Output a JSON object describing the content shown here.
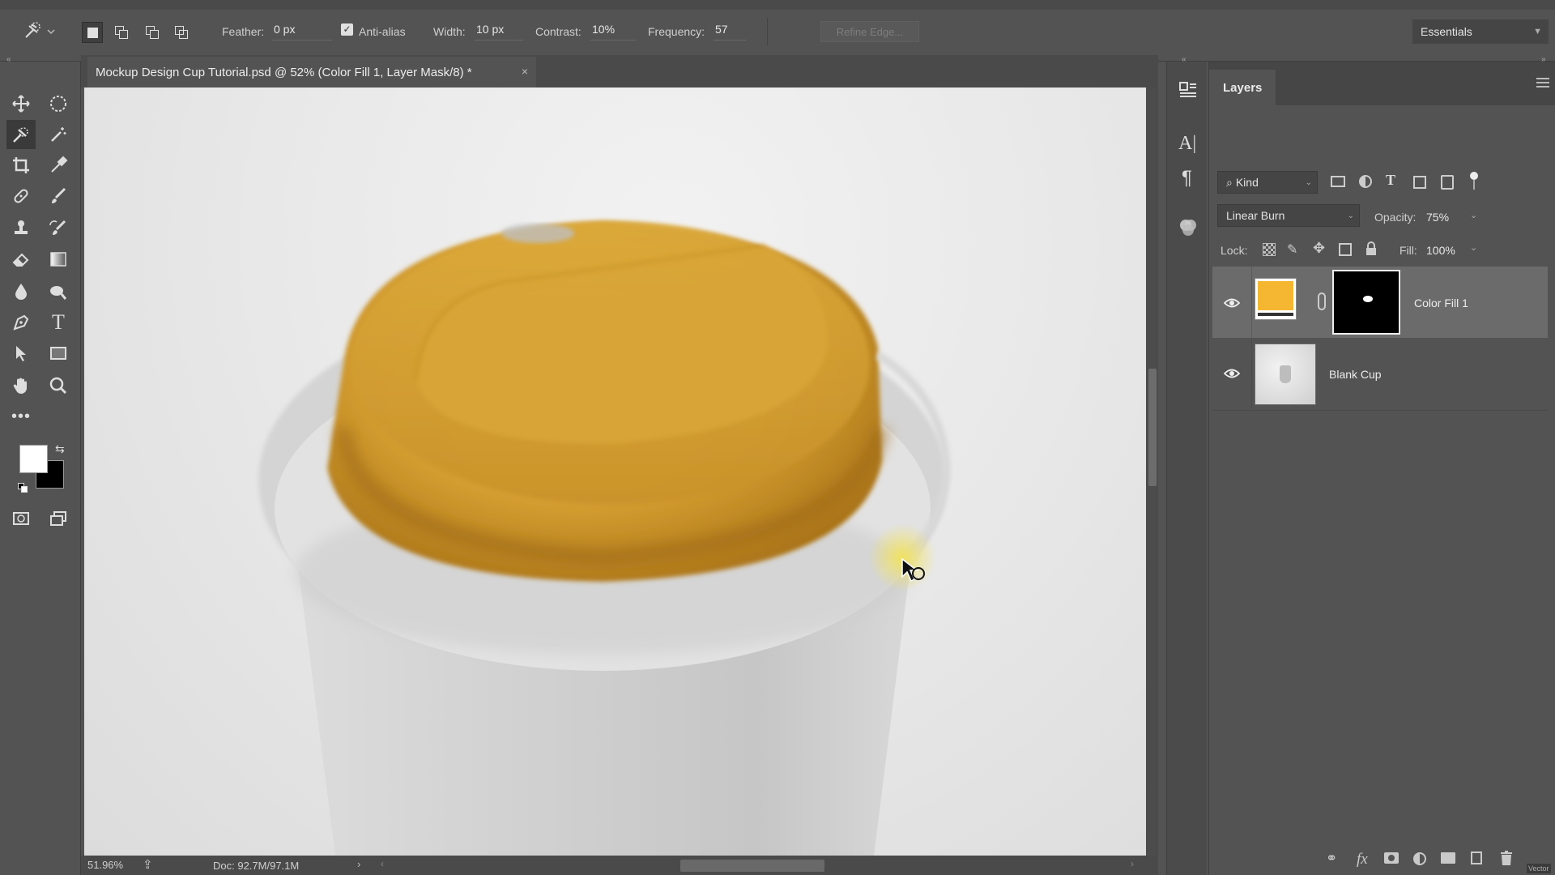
{
  "options_bar": {
    "feather_label": "Feather:",
    "feather_value": "0 px",
    "antialias_label": "Anti-alias",
    "antialias_checked": true,
    "width_label": "Width:",
    "width_value": "10 px",
    "contrast_label": "Contrast:",
    "contrast_value": "10%",
    "frequency_label": "Frequency:",
    "frequency_value": "57",
    "refine_edge_label": "Refine Edge...",
    "workspace_label": "Essentials"
  },
  "document": {
    "tab_title": "Mockup Design Cup Tutorial.psd @ 52% (Color Fill 1, Layer Mask/8) *",
    "close_glyph": "×"
  },
  "status_bar": {
    "zoom": "51.96%",
    "doc_size": "Doc: 92.7M/97.1M"
  },
  "layers_panel": {
    "title": "Layers",
    "filter_kind": "Kind",
    "blend_mode": "Linear Burn",
    "opacity_label": "Opacity:",
    "opacity_value": "75%",
    "lock_label": "Lock:",
    "fill_label": "Fill:",
    "fill_value": "100%",
    "layers": [
      {
        "name": "Color Fill 1",
        "visible": true,
        "selected": true,
        "swatch_color": "#F5B731"
      },
      {
        "name": "Blank Cup",
        "visible": true,
        "selected": false
      }
    ],
    "bottom_icons": [
      "link-icon",
      "fx-icon",
      "mask-icon",
      "adjustment-icon",
      "folder-icon",
      "new-layer-icon",
      "trash-icon"
    ],
    "fx_label": "fx",
    "corner_badge": "Vector"
  },
  "colors": {
    "accent_fill": "#F5B731",
    "foreground": "#FFFFFF",
    "background": "#000000"
  }
}
